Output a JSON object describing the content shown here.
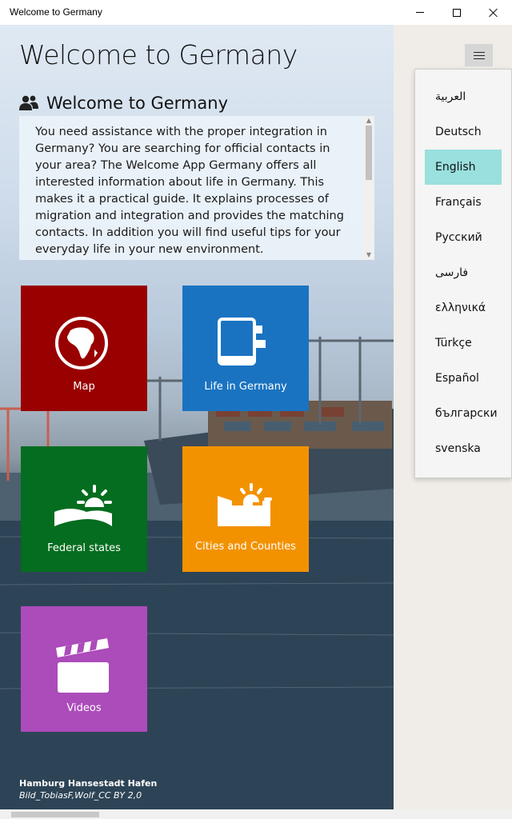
{
  "window": {
    "title": "Welcome to Germany",
    "min_symbol": "minimize",
    "max_symbol": "maximize",
    "close_symbol": "close"
  },
  "header": {
    "title": "Welcome to Germany"
  },
  "section": {
    "title": "Welcome to Germany",
    "icon": "people-icon",
    "description": "You need assistance with the proper integration in Germany? You are searching for official contacts in your area? The Welcome App Germany offers all interested information about life in Germany. This makes it a practical guide. It explains processes of migration and integration and provides the matching contacts. In addition you will find useful tips for your everyday life in your new environment."
  },
  "tiles": [
    {
      "label": "Map",
      "color": "#990000",
      "icon": "globe-africa-icon"
    },
    {
      "label": "Life in Germany",
      "color": "#1a73c1",
      "icon": "notebook-icon"
    },
    {
      "label": "Federal states",
      "color": "#046d1f",
      "icon": "sunrise-landscape-icon"
    },
    {
      "label": "Cities and Counties",
      "color": "#f39200",
      "icon": "city-sun-icon"
    },
    {
      "label": "Videos",
      "color": "#ac4bba",
      "icon": "clapperboard-icon"
    }
  ],
  "credit": {
    "line1": "Hamburg Hansestadt Hafen",
    "line2": "Bild_TobiasF,Wolf_CC BY 2,0"
  },
  "language_menu": {
    "selected": "English",
    "items": [
      "العربية",
      "Deutsch",
      "English",
      "Français",
      "Русский",
      "فارسی",
      "ελληνικά",
      "Türkçe",
      "Español",
      "български",
      "svenska"
    ]
  }
}
